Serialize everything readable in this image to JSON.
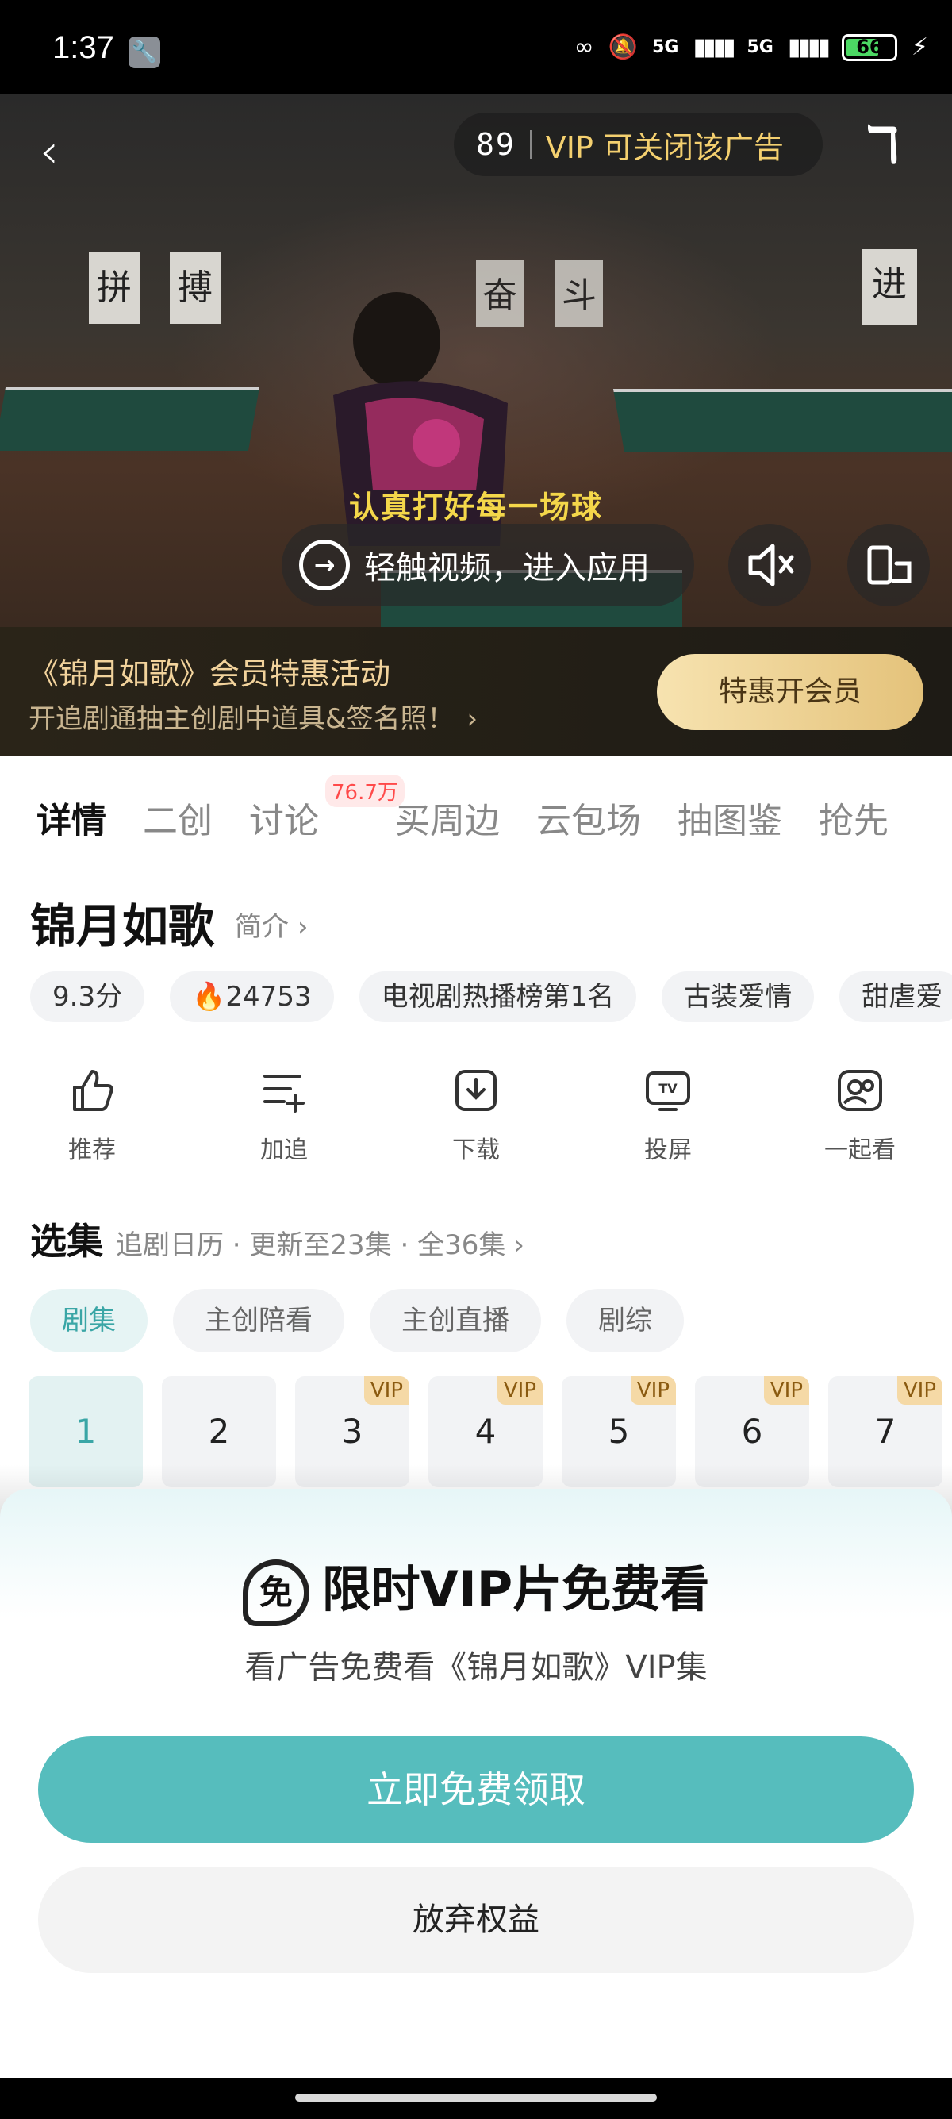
{
  "status": {
    "time": "1:37",
    "signal1": "5G",
    "signal2": "5G",
    "battery": "66"
  },
  "video": {
    "ad_countdown": "89",
    "ad_close_text": "VIP 可关闭该广告",
    "subtitle": "认真打好每一场球",
    "enter_app": "轻触视频，进入应用",
    "wall_banners": [
      "拼",
      "搏",
      "奋",
      "斗",
      "进"
    ]
  },
  "promo": {
    "title": "《锦月如歌》会员特惠活动",
    "subtitle": "开追剧通抽主创剧中道具&签名照！",
    "button": "特惠开会员"
  },
  "tabs": [
    {
      "label": "详情"
    },
    {
      "label": "二创"
    },
    {
      "label": "讨论",
      "badge": "76.7万"
    },
    {
      "label": "买周边"
    },
    {
      "label": "云包场"
    },
    {
      "label": "抽图鉴"
    },
    {
      "label": "抢先"
    }
  ],
  "show": {
    "title": "锦月如歌",
    "intro_link": "简介",
    "chips": [
      "9.3分",
      "24753",
      "电视剧热播榜第1名",
      "古装爱情",
      "甜虐爱"
    ]
  },
  "actions": [
    {
      "label": "推荐",
      "icon": "thumb-up-icon"
    },
    {
      "label": "加追",
      "icon": "add-list-icon"
    },
    {
      "label": "下载",
      "icon": "download-icon"
    },
    {
      "label": "投屏",
      "icon": "tv-icon"
    },
    {
      "label": "一起看",
      "icon": "watch-together-icon"
    }
  ],
  "selection": {
    "heading": "选集",
    "info": "追剧日历 · 更新至23集 · 全36集",
    "ep_tabs": [
      "剧集",
      "主创陪看",
      "主创直播",
      "剧综"
    ],
    "episodes": [
      {
        "num": "1",
        "vip": ""
      },
      {
        "num": "2",
        "vip": ""
      },
      {
        "num": "3",
        "vip": "VIP"
      },
      {
        "num": "4",
        "vip": "VIP"
      },
      {
        "num": "5",
        "vip": "VIP"
      },
      {
        "num": "6",
        "vip": "VIP"
      },
      {
        "num": "7",
        "vip": "VIP"
      }
    ]
  },
  "sheet": {
    "icon_char": "免",
    "title": "限时VIP片免费看",
    "subtitle": "看广告免费看《锦月如歌》VIP集",
    "claim_button": "立即免费领取",
    "give_up_button": "放弃权益"
  },
  "colors": {
    "accent": "#56bdbd",
    "gold": "#f4d06f",
    "vip_badge": "#f5d9a6"
  }
}
